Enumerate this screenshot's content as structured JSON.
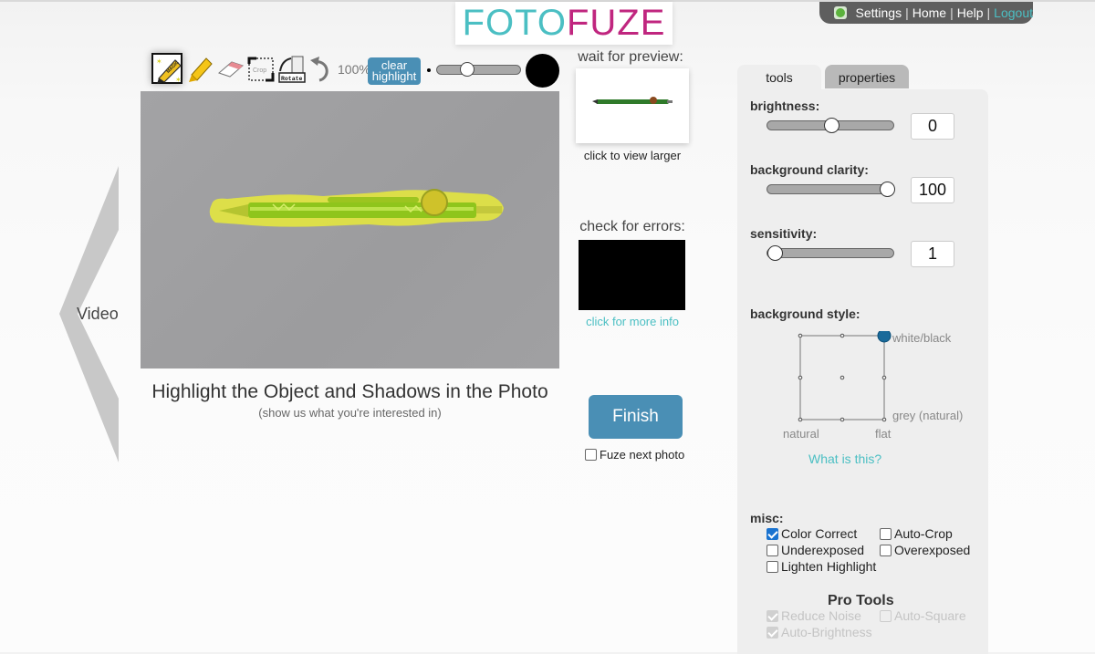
{
  "logo": {
    "part1": "FOTO",
    "part2": "FUZE",
    "colors": {
      "foto": "#4bbfc3",
      "fuze": "#c0267f"
    }
  },
  "topnav": {
    "icon": "leaf-logo-icon",
    "items": [
      {
        "label": "Settings"
      },
      {
        "label": "Home"
      },
      {
        "label": "Help"
      },
      {
        "label": "Logout"
      }
    ],
    "separator": "|"
  },
  "toolbar": {
    "tools": [
      {
        "name": "magic-highlighter",
        "label": "MAGIC",
        "selected": true
      },
      {
        "name": "highlighter",
        "selected": false
      },
      {
        "name": "eraser",
        "selected": false
      },
      {
        "name": "crop",
        "label": "Crop",
        "selected": false
      },
      {
        "name": "rotate",
        "label": "Rotate",
        "selected": false
      },
      {
        "name": "undo",
        "selected": false
      }
    ],
    "zoom": "100%",
    "clear_highlight": "clear highlight",
    "brush_size_fraction": 0.33
  },
  "video": {
    "label": "Video"
  },
  "instructions": {
    "title": "Highlight the Object and Shadows in the Photo",
    "subtitle": "(show us what you're interested in)"
  },
  "preview": {
    "label": "wait for preview:",
    "caption": "click to view larger"
  },
  "errors": {
    "label": "check for errors:",
    "link": "click for more info"
  },
  "finish": {
    "label": "Finish"
  },
  "fuze_next": {
    "label": "Fuze next photo",
    "checked": false
  },
  "panel": {
    "tabs": [
      {
        "label": "tools",
        "active": true
      },
      {
        "label": "properties",
        "active": false
      }
    ],
    "brightness": {
      "label": "brightness:",
      "value": "0",
      "fraction": 0.5
    },
    "background_clarity": {
      "label": "background clarity:",
      "value": "100",
      "fraction": 1.0
    },
    "sensitivity": {
      "label": "sensitivity:",
      "value": "1",
      "fraction": 0.0
    },
    "background_style": {
      "label": "background style:",
      "corner_top_right": "white/black",
      "corner_bottom_right": "grey (natural)",
      "axis_left": "natural",
      "axis_right": "flat",
      "selected": "top-right",
      "selected_color": "#1a6a9a",
      "help_link": "What is this?"
    },
    "misc": {
      "label": "misc:",
      "items": [
        {
          "label": "Color Correct",
          "checked": true
        },
        {
          "label": "Auto-Crop",
          "checked": false
        },
        {
          "label": "Underexposed",
          "checked": false
        },
        {
          "label": "Overexposed",
          "checked": false
        },
        {
          "label": "Lighten Highlight",
          "checked": false
        }
      ]
    },
    "pro_tools": {
      "title": "Pro Tools",
      "items": [
        {
          "label": "Reduce Noise",
          "checked": true,
          "disabled": true
        },
        {
          "label": "Auto-Square",
          "checked": false,
          "disabled": true
        },
        {
          "label": "Auto-Brightness",
          "checked": true,
          "disabled": true
        }
      ]
    }
  },
  "accent_colors": {
    "button": "#4a8fb5",
    "link": "#4bbfc3",
    "highlight": "#e6e600"
  }
}
